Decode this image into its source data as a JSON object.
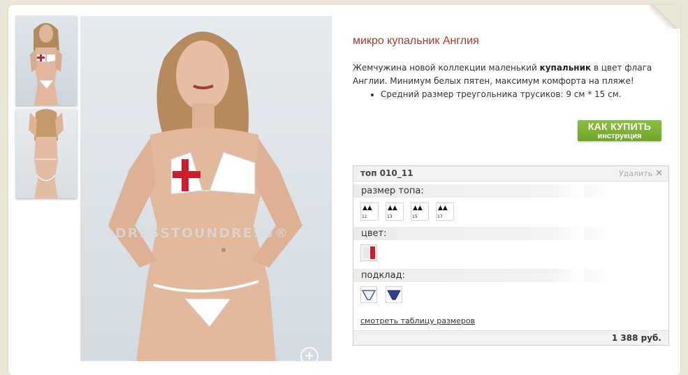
{
  "product": {
    "title": "микро купальник Англия",
    "desc_pre": "Жемчужина новой коллекции маленький ",
    "desc_bold": "купальник",
    "desc_post": " в цвет флага Англии. Минимум белых пятен, максимум комфорта на пляже!",
    "bullet": "Средний размер треугольника трусиков: 9 см * 15 см."
  },
  "photo": {
    "watermark": "DRESSTOUNDRESS®",
    "zoom_icon": "zoom-plus-icon"
  },
  "buy_button": {
    "line1": "КАК КУПИТЬ",
    "line2": "инструкция",
    "color": "#7cb334"
  },
  "options": {
    "name": "топ 010_11",
    "remove_label": "Удалить",
    "remove_icon": "close-icon",
    "size_label": "размер топа:",
    "sizes": [
      "11",
      "13",
      "15",
      "17"
    ],
    "color_label": "цвет:",
    "colors": [
      "white-red"
    ],
    "lining_label": "подклад:",
    "linings": [
      "white",
      "blue"
    ],
    "size_table_link": "смотреть таблицу размеров",
    "price": "1 388 руб."
  },
  "colors": {
    "title": "#a83d2c",
    "button_green": "#7cb334",
    "england_red": "#cc1f2b"
  }
}
